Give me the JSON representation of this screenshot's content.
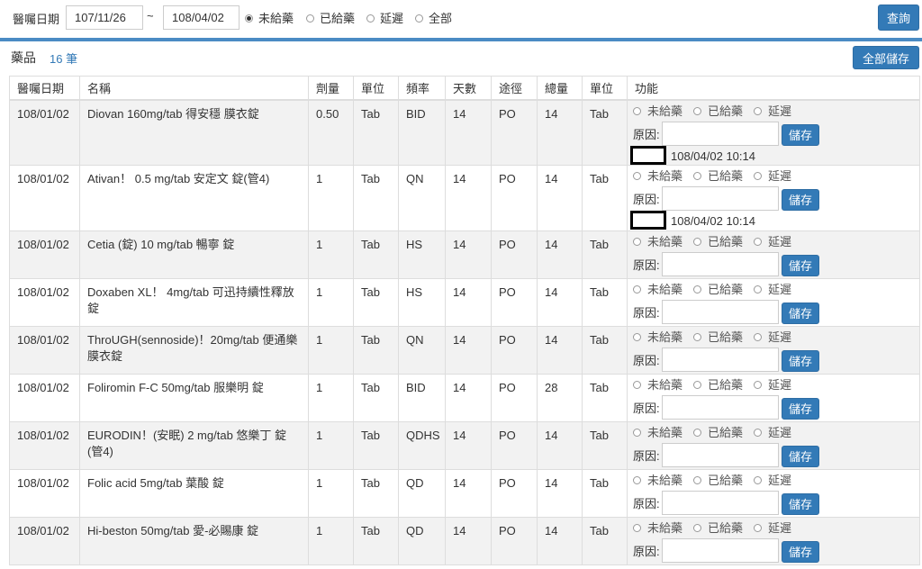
{
  "filter": {
    "date_label": "醫囑日期",
    "date_from": "107/11/26",
    "tilde": "~",
    "date_to": "108/04/02",
    "options": [
      "未給藥",
      "已給藥",
      "延遲",
      "全部"
    ],
    "selected_option": "未給藥",
    "query_button": "查詢"
  },
  "panel": {
    "title": "藥品",
    "count": "16 筆",
    "save_all_button": "全部儲存"
  },
  "table": {
    "headers": [
      "醫囑日期",
      "名稱",
      "劑量",
      "單位",
      "頻率",
      "天數",
      "途徑",
      "總量",
      "單位",
      "功能"
    ],
    "reason_label": "原因:",
    "save_button": "儲存",
    "status_options": [
      "未給藥",
      "已給藥",
      "延遲"
    ],
    "rows": [
      {
        "date": "108/01/02",
        "name": "Diovan 160mg/tab 得安穩 膜衣錠",
        "dose": "0.50",
        "unit": "Tab",
        "freq": "BID",
        "days": "14",
        "route": "PO",
        "total": "14",
        "unit2": "Tab",
        "stamp": "108/04/02 10:14"
      },
      {
        "date": "108/01/02",
        "name": "Ativan！ 0.5 mg/tab 安定文 錠(管4)",
        "dose": "1",
        "unit": "Tab",
        "freq": "QN",
        "days": "14",
        "route": "PO",
        "total": "14",
        "unit2": "Tab",
        "stamp": "108/04/02 10:14"
      },
      {
        "date": "108/01/02",
        "name": "Cetia (錠) 10 mg/tab 暢寧 錠",
        "dose": "1",
        "unit": "Tab",
        "freq": "HS",
        "days": "14",
        "route": "PO",
        "total": "14",
        "unit2": "Tab",
        "stamp": ""
      },
      {
        "date": "108/01/02",
        "name": "Doxaben XL！ 4mg/tab 可迅持續性釋放錠",
        "dose": "1",
        "unit": "Tab",
        "freq": "HS",
        "days": "14",
        "route": "PO",
        "total": "14",
        "unit2": "Tab",
        "stamp": ""
      },
      {
        "date": "108/01/02",
        "name": "ThroUGH(sennoside)！20mg/tab 便通樂 膜衣錠",
        "dose": "1",
        "unit": "Tab",
        "freq": "QN",
        "days": "14",
        "route": "PO",
        "total": "14",
        "unit2": "Tab",
        "stamp": ""
      },
      {
        "date": "108/01/02",
        "name": "Foliromin F-C 50mg/tab 服樂明 錠",
        "dose": "1",
        "unit": "Tab",
        "freq": "BID",
        "days": "14",
        "route": "PO",
        "total": "28",
        "unit2": "Tab",
        "stamp": ""
      },
      {
        "date": "108/01/02",
        "name": "EURODIN！(安眠) 2 mg/tab 悠樂丁 錠(管4)",
        "dose": "1",
        "unit": "Tab",
        "freq": "QDHS",
        "days": "14",
        "route": "PO",
        "total": "14",
        "unit2": "Tab",
        "stamp": ""
      },
      {
        "date": "108/01/02",
        "name": "Folic acid 5mg/tab 葉酸 錠",
        "dose": "1",
        "unit": "Tab",
        "freq": "QD",
        "days": "14",
        "route": "PO",
        "total": "14",
        "unit2": "Tab",
        "stamp": ""
      },
      {
        "date": "108/01/02",
        "name": "Hi-beston 50mg/tab 愛-必賜康 錠",
        "dose": "1",
        "unit": "Tab",
        "freq": "QD",
        "days": "14",
        "route": "PO",
        "total": "14",
        "unit2": "Tab",
        "stamp": ""
      }
    ]
  }
}
